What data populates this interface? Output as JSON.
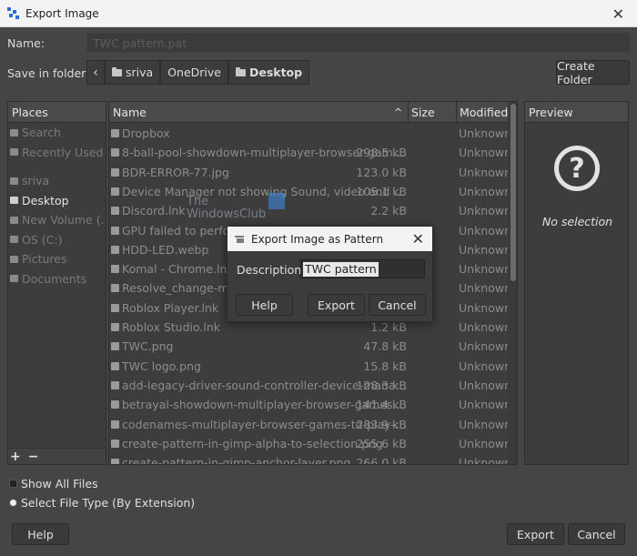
{
  "window": {
    "title": "Export Image",
    "close_glyph": "✕"
  },
  "name_label": "Name:",
  "name_value": "TWC pattern.pat",
  "save_in_label": "Save in folder:",
  "breadcrumb": {
    "back_glyph": "‹",
    "items": [
      "sriva",
      "OneDrive",
      "Desktop"
    ]
  },
  "create_folder_label": "Create Folder",
  "places": {
    "header": "Places",
    "items": [
      "Search",
      "Recently Used",
      "sriva",
      "Desktop",
      "New Volume (...",
      "OS (C:)",
      "Pictures",
      "Documents"
    ],
    "add_glyph": "+",
    "remove_glyph": "−"
  },
  "files": {
    "col_name": "Name",
    "col_size": "Size",
    "col_modified": "Modified",
    "sort_glyph": "^",
    "rows": [
      {
        "name": "Dropbox",
        "size": "",
        "modified": "Unknown"
      },
      {
        "name": "8-ball-pool-showdown-multiplayer-browser-games-to-pl...",
        "size": "298.5 kB",
        "modified": "Unknown"
      },
      {
        "name": "BDR-ERROR-77.jpg",
        "size": "123.0 kB",
        "modified": "Unknown"
      },
      {
        "name": "Device Manager not showing Sound, video and game c...",
        "size": "105.1 kB",
        "modified": "Unknown"
      },
      {
        "name": "Discord.lnk",
        "size": "2.2 kB",
        "modified": "Unknown"
      },
      {
        "name": "GPU failed to perform...",
        "size": "",
        "modified": "Unknown"
      },
      {
        "name": "HDD-LED.webp",
        "size": "",
        "modified": "Unknown"
      },
      {
        "name": "Komal - Chrome.lnk",
        "size": "",
        "modified": "Unknown"
      },
      {
        "name": "Resolve_change-mem...",
        "size": "",
        "modified": "Unknown"
      },
      {
        "name": "Roblox Player.lnk",
        "size": "",
        "modified": "Unknown"
      },
      {
        "name": "Roblox Studio.lnk",
        "size": "1.2 kB",
        "modified": "Unknown"
      },
      {
        "name": "TWC.png",
        "size": "47.8 kB",
        "modified": "Unknown"
      },
      {
        "name": "TWC logo.png",
        "size": "15.8 kB",
        "modified": "Unknown"
      },
      {
        "name": "add-legacy-driver-sound-controller-device-manager.png",
        "size": "128.3 kB",
        "modified": "Unknown"
      },
      {
        "name": "betrayal-showdown-multiplayer-browser-games-to-play...",
        "size": "141.4 kB",
        "modified": "Unknown"
      },
      {
        "name": "codenames-multiplayer-browser-games-to-play-with-fri...",
        "size": "283.9 kB",
        "modified": "Unknown"
      },
      {
        "name": "create-pattern-in-gimp-alpha-to-selection.png",
        "size": "255.6 kB",
        "modified": "Unknown"
      },
      {
        "name": "create-pattern-in-gimp-anchor-layer.png",
        "size": "266.0 kB",
        "modified": "Unknown"
      }
    ]
  },
  "preview": {
    "header": "Preview",
    "icon_glyph": "?",
    "empty_text": "No selection"
  },
  "show_all_files": "Show All Files",
  "select_file_type": "Select File Type (By Extension)",
  "help_label": "Help",
  "export_label": "Export",
  "cancel_label": "Cancel",
  "watermark": {
    "line1": "The",
    "line2": "WindowsClub"
  },
  "modal": {
    "title": "Export Image as Pattern",
    "close_glyph": "✕",
    "desc_label": "Description:",
    "desc_value": "TWC pattern",
    "help": "Help",
    "export": "Export",
    "cancel": "Cancel"
  }
}
